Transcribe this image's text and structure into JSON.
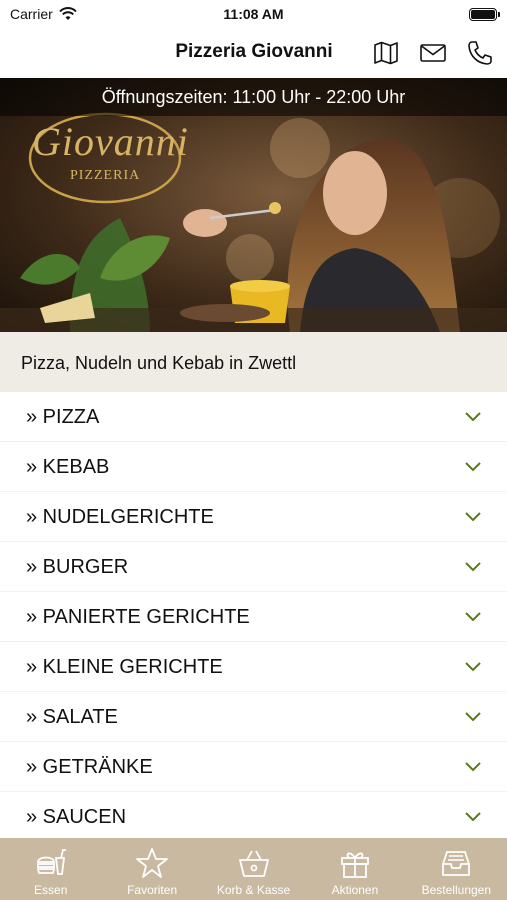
{
  "status_bar": {
    "carrier": "Carrier",
    "time": "11:08 AM"
  },
  "nav": {
    "title": "Pizzeria Giovanni",
    "icons": [
      "map-icon",
      "mail-icon",
      "phone-icon"
    ]
  },
  "hero": {
    "hours": "Öffnungszeiten: 11:00 Uhr - 22:00 Uhr",
    "logo_script": "Giovanni",
    "logo_sub": "PIZZERIA"
  },
  "subtitle": "Pizza, Nudeln und Kebab in Zwettl",
  "menu": {
    "items": [
      "» PIZZA",
      "» KEBAB",
      "» NUDELGERICHTE",
      "» BURGER",
      "» PANIERTE GERICHTE",
      "» KLEINE GERICHTE",
      "» SALATE",
      "» GETRÄNKE",
      "» SAUCEN"
    ],
    "chevron_color": "#5b7a1e"
  },
  "tabs": [
    {
      "label": "Essen",
      "icon": "burger-drink-icon"
    },
    {
      "label": "Favoriten",
      "icon": "star-icon"
    },
    {
      "label": "Korb & Kasse",
      "icon": "basket-icon"
    },
    {
      "label": "Aktionen",
      "icon": "gift-icon"
    },
    {
      "label": "Bestellungen",
      "icon": "inbox-tray-icon"
    }
  ],
  "colors": {
    "tab_bar": "#c9b9a0",
    "subtitle_bg": "#efebe5",
    "accent": "#5b7a1e"
  }
}
